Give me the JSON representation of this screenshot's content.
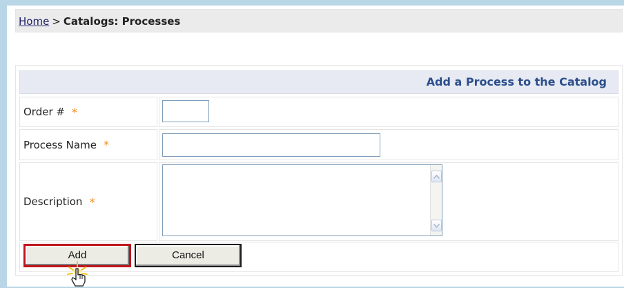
{
  "breadcrumb": {
    "home": "Home",
    "separator": ">",
    "current": "Catalogs: Processes"
  },
  "form": {
    "title": "Add a Process to the Catalog",
    "required_mark": "*",
    "fields": [
      {
        "label": "Order #",
        "value": ""
      },
      {
        "label": "Process Name",
        "value": ""
      },
      {
        "label": "Description",
        "value": ""
      }
    ]
  },
  "buttons": {
    "add": "Add",
    "cancel": "Cancel"
  },
  "colors": {
    "required_mark": "#f08a1c",
    "form_title": "#2b4f8c",
    "focused_button_border": "#c0141c"
  },
  "icons": {
    "cursor": "hand-pointer-icon",
    "scroll_up": "scroll-up-arrow-icon",
    "scroll_down": "scroll-down-arrow-icon"
  }
}
